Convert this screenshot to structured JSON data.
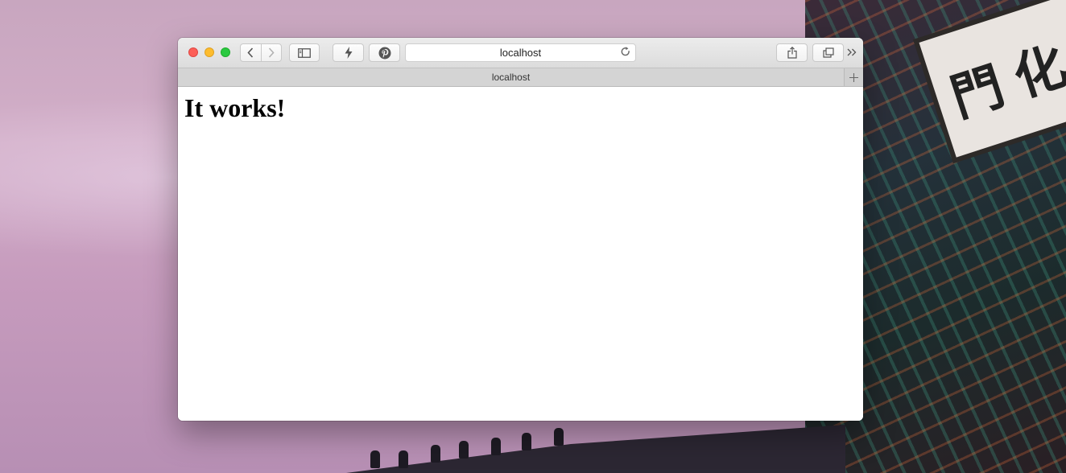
{
  "browser": {
    "address_text": "localhost",
    "tab_title": "localhost"
  },
  "page": {
    "heading": "It works!"
  },
  "icons": {
    "back": "chevron-left-icon",
    "forward": "chevron-right-icon",
    "sidebar": "sidebar-icon",
    "bolt": "bolt-icon",
    "pinterest": "pinterest-icon",
    "reload": "reload-icon",
    "share": "share-icon",
    "tabs": "tabs-overview-icon",
    "more": "double-chevron-right-icon",
    "new_tab": "plus-icon"
  },
  "colors": {
    "close": "#fc5f57",
    "minimize": "#fdbc2e",
    "maximize": "#2ac940"
  }
}
